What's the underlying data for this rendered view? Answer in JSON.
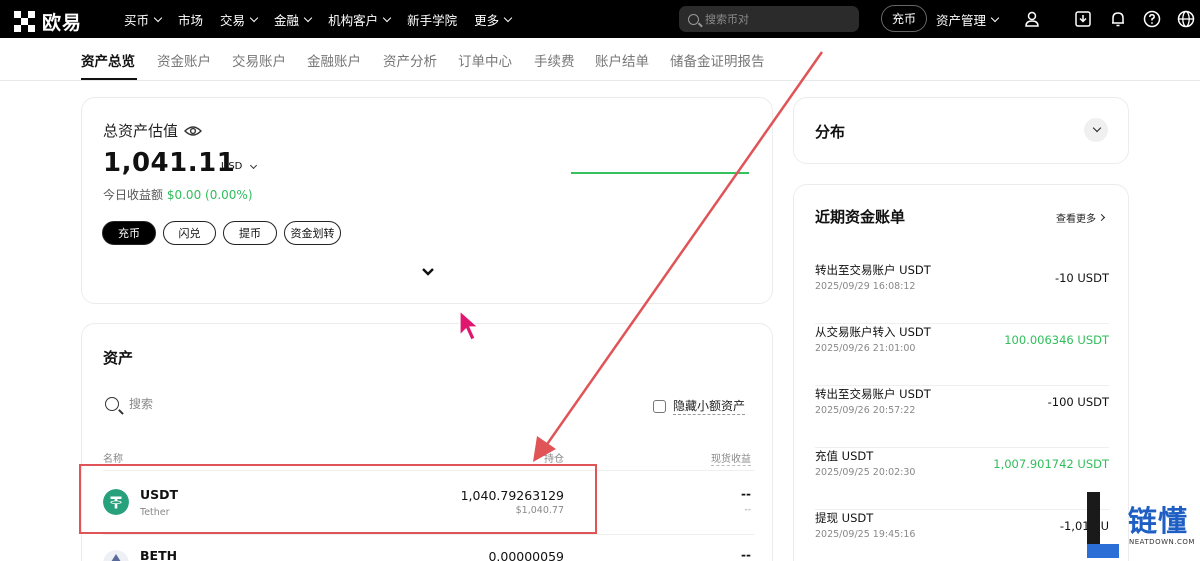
{
  "topbar": {
    "logo_text": "欧易",
    "nav": [
      {
        "label": "买币",
        "has_menu": true
      },
      {
        "label": "市场",
        "has_menu": false
      },
      {
        "label": "交易",
        "has_menu": true
      },
      {
        "label": "金融",
        "has_menu": true
      },
      {
        "label": "机构客户",
        "has_menu": true
      },
      {
        "label": "新手学院",
        "has_menu": false
      },
      {
        "label": "更多",
        "has_menu": true
      }
    ],
    "search_placeholder": "搜索币对",
    "deposit_label": "充币",
    "asset_mgmt_label": "资产管理",
    "icons": [
      "user-icon",
      "download-icon",
      "bell-icon",
      "help-icon",
      "globe-icon"
    ]
  },
  "subtabs": [
    "资产总览",
    "资金账户",
    "交易账户",
    "金融账户",
    "资产分析",
    "订单中心",
    "手续费",
    "账户结单",
    "储备金证明报告"
  ],
  "overview": {
    "title": "总资产估值",
    "value": "1,041.11",
    "currency": "USD",
    "pnl_label": "今日收益额",
    "pnl_value": "$0.00 (0.00%)",
    "buttons": [
      "充币",
      "闪兑",
      "提币",
      "资金划转"
    ]
  },
  "assets": {
    "title": "资产",
    "search_placeholder": "搜索",
    "hide_small_label": "隐藏小额资产",
    "col_name": "名称",
    "col_holding": "持仓",
    "col_spot_pnl": "现货收益",
    "rows": [
      {
        "symbol": "USDT",
        "name": "Tether",
        "amount": "1,040.79263129",
        "usd": "$1,040.77",
        "pnl": "--",
        "pnl2": "--"
      },
      {
        "symbol": "BETH",
        "name": "",
        "amount": "0.00000059",
        "usd": "",
        "pnl": "--",
        "pnl2": ""
      }
    ]
  },
  "distribution": {
    "title": "分布"
  },
  "bills": {
    "title": "近期资金账单",
    "more_label": "查看更多",
    "items": [
      {
        "name": "转出至交易账户 USDT",
        "time": "2025/09/29 16:08:12",
        "amount": "-10 USDT",
        "positive": false
      },
      {
        "name": "从交易账户转入 USDT",
        "time": "2025/09/26 21:01:00",
        "amount": "100.006346 USDT",
        "positive": true
      },
      {
        "name": "转出至交易账户 USDT",
        "time": "2025/09/26 20:57:22",
        "amount": "-100 USDT",
        "positive": false
      },
      {
        "name": "充值 USDT",
        "time": "2025/09/25 20:02:30",
        "amount": "1,007.901742 USDT",
        "positive": true
      },
      {
        "name": "提现 USDT",
        "time": "2025/09/25 19:45:16",
        "amount": "-1,010 U",
        "positive": false
      }
    ]
  },
  "watermark": {
    "text": "链懂",
    "sub": "NEATDOWN.COM"
  },
  "colors": {
    "positive": "#2fbe5b",
    "annotation": "#e05457",
    "cursor": "#e0176f",
    "watermark": "#1f5fc4"
  }
}
